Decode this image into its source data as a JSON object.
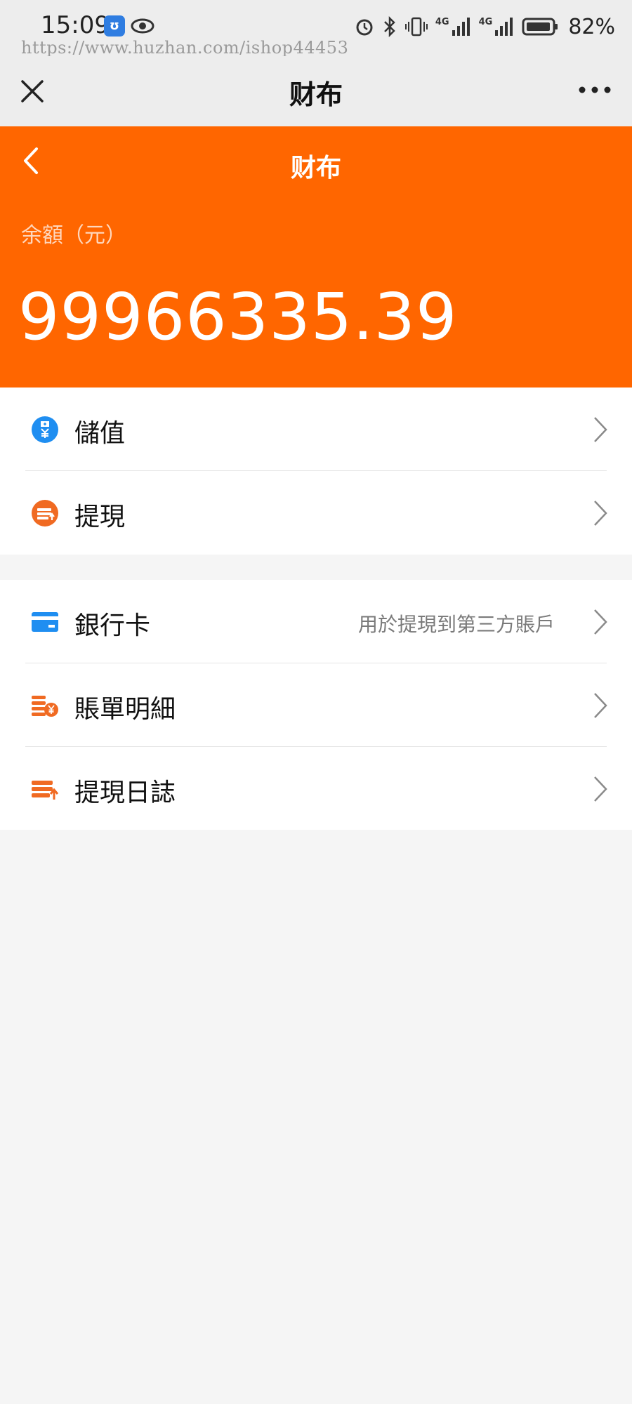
{
  "status_bar": {
    "time": "15:09",
    "battery_percent": "82%",
    "network_labels": [
      "4G",
      "4G"
    ]
  },
  "watermark": "https://www.huzhan.com/ishop44453",
  "top_bar": {
    "title": "财布",
    "close_icon": "close-icon",
    "more_icon": "more-icon"
  },
  "header": {
    "title": "财布",
    "balance_label": "余額（元）",
    "balance_value": "99966335.39",
    "background_color": "#ff6600"
  },
  "menu_group_1": [
    {
      "label": "儲值",
      "icon": "recharge-icon",
      "icon_color": "#1f8ef1"
    },
    {
      "label": "提現",
      "icon": "withdraw-icon",
      "icon_color": "#f06a22"
    }
  ],
  "menu_group_2": [
    {
      "label": "銀行卡",
      "description": "用於提現到第三方賬戶",
      "icon": "bank-card-icon",
      "icon_color": "#1f8ef1"
    },
    {
      "label": "賬單明細",
      "icon": "bill-details-icon",
      "icon_color": "#f06a22"
    },
    {
      "label": "提現日誌",
      "icon": "withdraw-log-icon",
      "icon_color": "#f06a22"
    }
  ]
}
